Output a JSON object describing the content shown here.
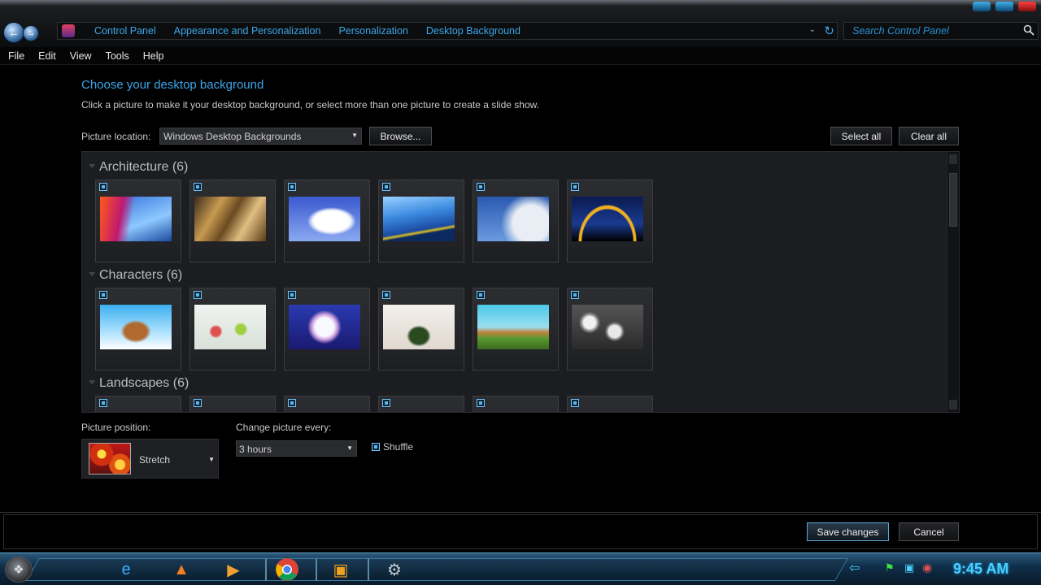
{
  "breadcrumb": [
    "Control Panel",
    "Appearance and Personalization",
    "Personalization",
    "Desktop Background"
  ],
  "search": {
    "placeholder": "Search Control Panel"
  },
  "menu": [
    "File",
    "Edit",
    "View",
    "Tools",
    "Help"
  ],
  "page": {
    "heading": "Choose your desktop background",
    "subtext": "Click a picture to make it your desktop background, or select more than one picture to create a slide show."
  },
  "location": {
    "label": "Picture location:",
    "value": "Windows Desktop Backgrounds",
    "browse": "Browse...",
    "select_all": "Select all",
    "clear_all": "Clear all"
  },
  "groups": [
    {
      "title": "Architecture (6)"
    },
    {
      "title": "Characters (6)"
    },
    {
      "title": "Landscapes (6)"
    }
  ],
  "position": {
    "label": "Picture position:",
    "value": "Stretch"
  },
  "change": {
    "label": "Change picture every:",
    "value": "3 hours"
  },
  "shuffle": {
    "label": "Shuffle"
  },
  "footer": {
    "save": "Save changes",
    "cancel": "Cancel"
  },
  "taskbar": {
    "time": "9:45 AM"
  },
  "colors": {
    "accent": "#3aa6e8",
    "clock": "#4ad0ff"
  }
}
